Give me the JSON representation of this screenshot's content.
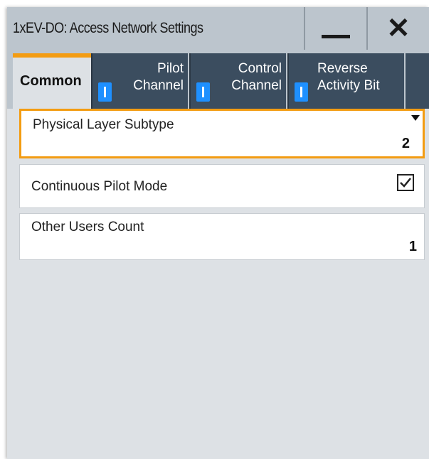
{
  "window": {
    "title": "1xEV-DO: Access Network Settings"
  },
  "tabs": [
    {
      "label": "Common",
      "active": true
    },
    {
      "label_line1": "Pilot",
      "label_line2": "Channel",
      "state_indicator": "on"
    },
    {
      "label_line1": "Control",
      "label_line2": "Channel",
      "state_indicator": "on"
    },
    {
      "label_line1": "Reverse",
      "label_line2": "Activity Bit",
      "state_indicator": "on"
    }
  ],
  "fields": {
    "physical_layer_subtype": {
      "label": "Physical Layer Subtype",
      "value": "2"
    },
    "continuous_pilot_mode": {
      "label": "Continuous Pilot Mode",
      "checked": true
    },
    "other_users_count": {
      "label": "Other Users Count",
      "value": "1"
    }
  },
  "colors": {
    "accent": "#f39c12",
    "tab_dark": "#3b4d5f",
    "indicator": "#1e90ff",
    "titlebar": "#bcc5cd",
    "panel": "#dde1e5"
  },
  "icons": {
    "minimize": "minimize-icon",
    "close": "close-icon",
    "dropdown": "chevron-down-icon",
    "checkbox": "checkmark-icon"
  }
}
